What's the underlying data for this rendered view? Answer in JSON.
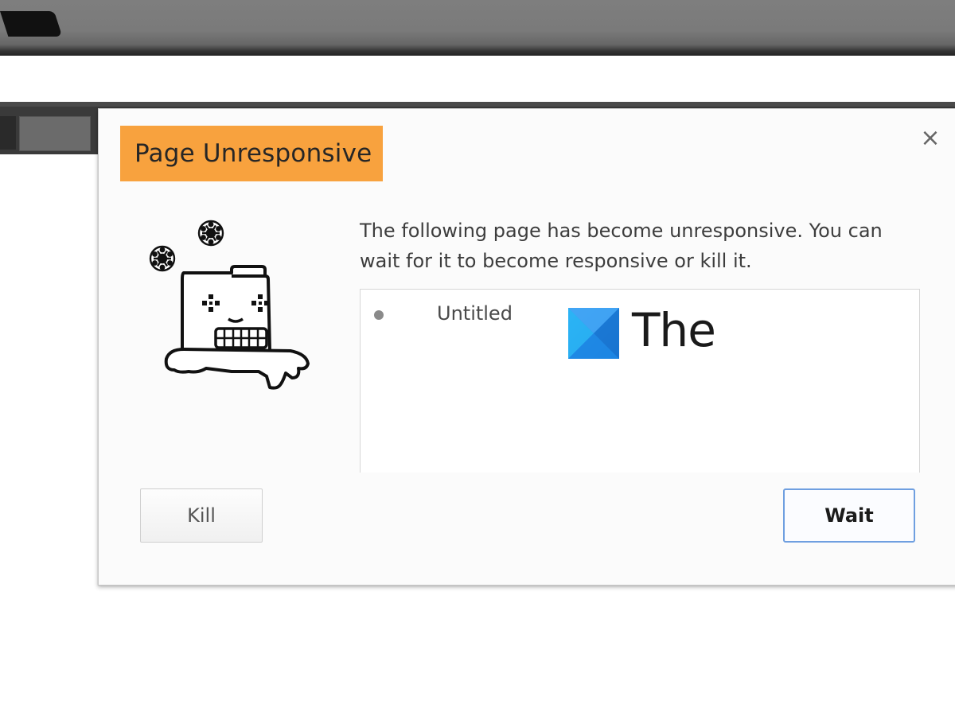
{
  "dialog": {
    "title": "Page Unresponsive",
    "close_glyph": "×",
    "message": "The following page has become unresponsive. You can wait for it to become responsive or kill it.",
    "pages": [
      {
        "label": "Untitled"
      }
    ],
    "buttons": {
      "kill_label": "Kill",
      "wait_label": "Wait"
    }
  },
  "watermark": {
    "text": "The"
  },
  "icons": {
    "close": "close-icon",
    "illustration": "frozen-page-icon",
    "watermark_logo": "windows-logo-icon",
    "page_bullet": "bullet-icon"
  },
  "colors": {
    "title_badge": "#f8a23e",
    "wait_border": "#6f9fe0",
    "watermark_logo_blue": "#1e88e5"
  }
}
